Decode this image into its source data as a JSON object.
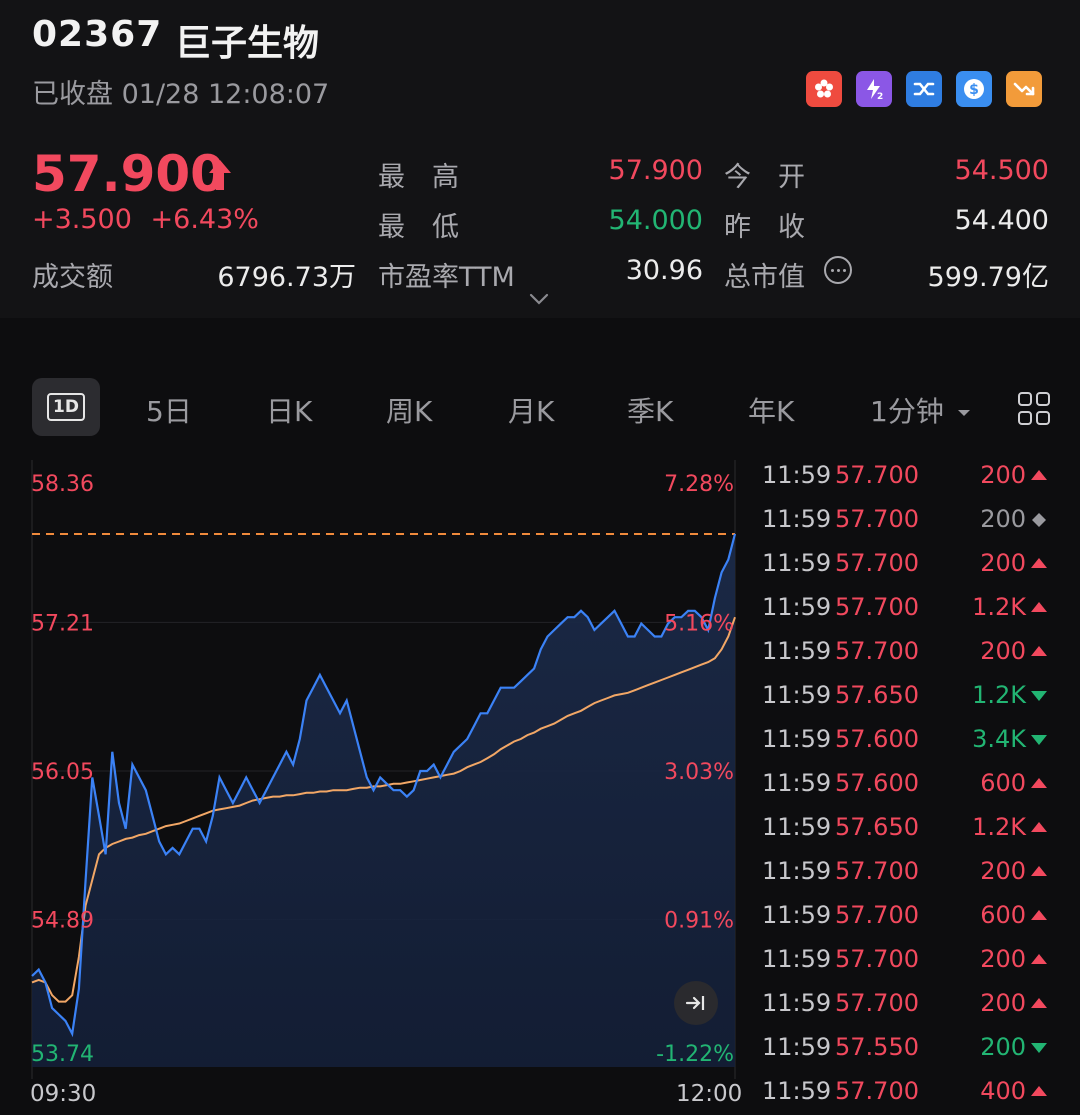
{
  "stock": {
    "code": "02367",
    "name": "巨子生物",
    "status": "已收盘 01/28 12:08:07",
    "price": "57.900",
    "change": "+3.500",
    "change_pct": "+6.43%"
  },
  "stats": {
    "high_label": "最　高",
    "high": "57.900",
    "open_label": "今　开",
    "open": "54.500",
    "low_label": "最　低",
    "low": "54.000",
    "prev_close_label": "昨　收",
    "prev_close": "54.400",
    "turnover_label": "成交额",
    "turnover": "6796.73万",
    "pe_label": "市盈率TTM",
    "pe": "30.96",
    "mktcap_label": "总市值",
    "mktcap": "599.79亿"
  },
  "badges": [
    {
      "icon": "hk-flower-icon",
      "color": "#ef4b3f"
    },
    {
      "icon": "level2-icon",
      "color": "#8b57e6"
    },
    {
      "icon": "connect-icon",
      "color": "#2f7de1"
    },
    {
      "icon": "dollar-icon",
      "color": "#3a8ef0"
    },
    {
      "icon": "short-sell-icon",
      "color": "#f29b3a"
    }
  ],
  "tabs": {
    "active": "1D",
    "items": [
      "5日",
      "日K",
      "周K",
      "月K",
      "季K",
      "年K"
    ],
    "period": "1分钟"
  },
  "chart_data": {
    "type": "line",
    "x_start_label": "09:30",
    "x_end_label": "12:00",
    "y_ticks": [
      "58.36",
      "57.21",
      "56.05",
      "54.89",
      "53.74"
    ],
    "pct_ticks": [
      "7.28%",
      "5.16%",
      "3.03%",
      "0.91%",
      "-1.22%"
    ],
    "ylim": [
      53.74,
      58.36
    ],
    "reference_price": 57.9,
    "series": [
      {
        "color": "#3b82f6",
        "values": [
          54.45,
          54.5,
          54.4,
          54.2,
          54.15,
          54.1,
          54.0,
          54.35,
          55.2,
          56.0,
          55.7,
          55.4,
          56.2,
          55.8,
          55.6,
          56.1,
          56.0,
          55.9,
          55.7,
          55.5,
          55.4,
          55.45,
          55.4,
          55.5,
          55.6,
          55.6,
          55.5,
          55.7,
          56.0,
          55.9,
          55.8,
          55.9,
          56.0,
          55.9,
          55.8,
          55.9,
          56.0,
          56.1,
          56.2,
          56.1,
          56.3,
          56.6,
          56.7,
          56.8,
          56.7,
          56.6,
          56.5,
          56.6,
          56.4,
          56.2,
          56.0,
          55.9,
          56.0,
          55.95,
          55.9,
          55.9,
          55.85,
          55.9,
          56.05,
          56.05,
          56.1,
          56.0,
          56.1,
          56.2,
          56.25,
          56.3,
          56.4,
          56.5,
          56.5,
          56.6,
          56.7,
          56.7,
          56.7,
          56.75,
          56.8,
          56.85,
          57.0,
          57.1,
          57.15,
          57.2,
          57.25,
          57.25,
          57.3,
          57.25,
          57.15,
          57.2,
          57.25,
          57.3,
          57.2,
          57.1,
          57.1,
          57.2,
          57.15,
          57.1,
          57.1,
          57.2,
          57.25,
          57.25,
          57.3,
          57.3,
          57.25,
          57.15,
          57.4,
          57.6,
          57.7,
          57.9
        ]
      },
      {
        "color": "#f2a766",
        "values": [
          54.4,
          54.42,
          54.4,
          54.3,
          54.25,
          54.25,
          54.3,
          54.6,
          55.0,
          55.2,
          55.4,
          55.45,
          55.48,
          55.5,
          55.52,
          55.53,
          55.55,
          55.56,
          55.58,
          55.6,
          55.62,
          55.63,
          55.64,
          55.66,
          55.68,
          55.7,
          55.72,
          55.74,
          55.75,
          55.76,
          55.77,
          55.78,
          55.8,
          55.82,
          55.83,
          55.84,
          55.85,
          55.85,
          55.86,
          55.86,
          55.87,
          55.88,
          55.88,
          55.89,
          55.89,
          55.9,
          55.9,
          55.9,
          55.91,
          55.92,
          55.92,
          55.93,
          55.93,
          55.94,
          55.95,
          55.95,
          55.96,
          55.97,
          55.98,
          55.99,
          56.0,
          56.01,
          56.02,
          56.03,
          56.05,
          56.08,
          56.1,
          56.12,
          56.15,
          56.18,
          56.22,
          56.25,
          56.28,
          56.3,
          56.33,
          56.35,
          56.38,
          56.4,
          56.42,
          56.45,
          56.48,
          56.5,
          56.52,
          56.55,
          56.58,
          56.6,
          56.62,
          56.64,
          56.65,
          56.66,
          56.68,
          56.7,
          56.72,
          56.74,
          56.76,
          56.78,
          56.8,
          56.82,
          56.84,
          56.86,
          56.88,
          56.9,
          56.93,
          57.0,
          57.1,
          57.25
        ]
      }
    ]
  },
  "trades": [
    {
      "time": "11:59",
      "price": "57.700",
      "vol": "200",
      "dir": "up"
    },
    {
      "time": "11:59",
      "price": "57.700",
      "vol": "200",
      "dir": "flat"
    },
    {
      "time": "11:59",
      "price": "57.700",
      "vol": "200",
      "dir": "up"
    },
    {
      "time": "11:59",
      "price": "57.700",
      "vol": "1.2K",
      "dir": "up"
    },
    {
      "time": "11:59",
      "price": "57.700",
      "vol": "200",
      "dir": "up"
    },
    {
      "time": "11:59",
      "price": "57.650",
      "vol": "1.2K",
      "dir": "down"
    },
    {
      "time": "11:59",
      "price": "57.600",
      "vol": "3.4K",
      "dir": "down"
    },
    {
      "time": "11:59",
      "price": "57.600",
      "vol": "600",
      "dir": "up"
    },
    {
      "time": "11:59",
      "price": "57.650",
      "vol": "1.2K",
      "dir": "up"
    },
    {
      "time": "11:59",
      "price": "57.700",
      "vol": "200",
      "dir": "up"
    },
    {
      "time": "11:59",
      "price": "57.700",
      "vol": "600",
      "dir": "up"
    },
    {
      "time": "11:59",
      "price": "57.700",
      "vol": "200",
      "dir": "up"
    },
    {
      "time": "11:59",
      "price": "57.700",
      "vol": "200",
      "dir": "up"
    },
    {
      "time": "11:59",
      "price": "57.550",
      "vol": "200",
      "dir": "down"
    },
    {
      "time": "11:59",
      "price": "57.700",
      "vol": "400",
      "dir": "up"
    }
  ],
  "colors": {
    "up": "#f2495e",
    "down": "#22b573",
    "flat": "#9a9a9f",
    "accent": "#3b82f6",
    "avg": "#f2a766"
  }
}
